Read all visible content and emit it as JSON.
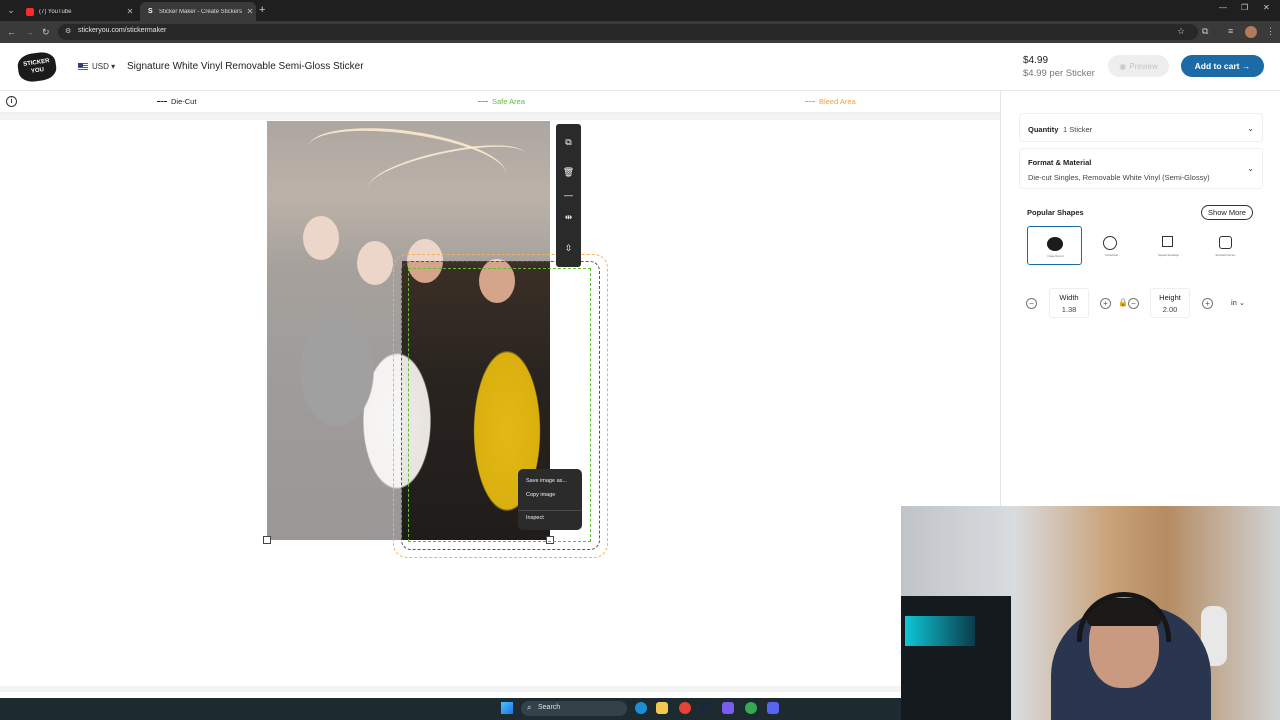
{
  "browser": {
    "tabs": [
      {
        "title": "(7) YouTube",
        "active": false
      },
      {
        "title": "Sticker Maker - Create Stickers",
        "active": true
      }
    ],
    "url": "stickeryou.com/stickermaker"
  },
  "header": {
    "logo_text": "STICKER YOU",
    "currency": "USD",
    "product_title": "Signature White Vinyl Removable Semi-Gloss Sticker",
    "price": "$4.99",
    "price_per": "$4.99 per Sticker",
    "preview_label": "Preview",
    "add_to_cart_label": "Add to cart →"
  },
  "legend": {
    "die_cut": "Die-Cut",
    "safe_area": "Safe Area",
    "bleed_area": "Bleed Area"
  },
  "context_menu": {
    "items": [
      "Save image as...",
      "Copy image",
      "Inspect"
    ]
  },
  "panel": {
    "quantity_label": "Quantity",
    "quantity_value": "1 Sticker",
    "format_label": "Format & Material",
    "format_value": "Die-cut Singles, Removable White Vinyl (Semi-Glossy)",
    "popular_shapes_label": "Popular Shapes",
    "show_more_label": "Show More",
    "shapes": [
      {
        "caption": "Image Die-Cut"
      },
      {
        "caption": "Circle/Oval"
      },
      {
        "caption": "Square/ Rectangle"
      },
      {
        "caption": "Rounded Corners"
      }
    ],
    "width_label": "Width",
    "width_value": "1.38",
    "height_label": "Height",
    "height_value": "2.00",
    "unit": "in"
  },
  "taskbar": {
    "search_label": "Search"
  },
  "colors": {
    "accent": "#1c6aa6",
    "safe_area": "#5fbf2f",
    "bleed_area": "#f0a040"
  }
}
